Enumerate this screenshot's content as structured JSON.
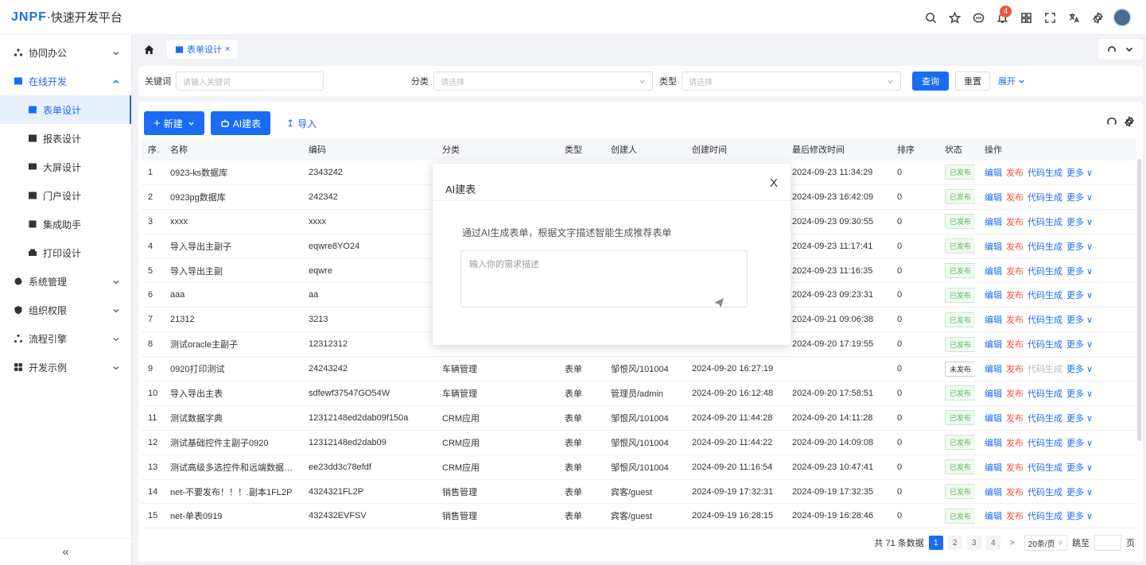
{
  "app": {
    "logo_brand": "JNPF",
    "logo_sep": "·",
    "logo_title": "快速开发平台",
    "notification_count": "4"
  },
  "sidebar": {
    "items": [
      {
        "label": "协同办公",
        "icon": "collab-icon"
      },
      {
        "label": "在线开发",
        "icon": "dev-icon"
      },
      {
        "label": "表单设计",
        "icon": "form-icon"
      },
      {
        "label": "报表设计",
        "icon": "report-icon"
      },
      {
        "label": "大屏设计",
        "icon": "screen-icon"
      },
      {
        "label": "门户设计",
        "icon": "portal-icon"
      },
      {
        "label": "集成助手",
        "icon": "integration-icon"
      },
      {
        "label": "打印设计",
        "icon": "print-icon"
      },
      {
        "label": "系统管理",
        "icon": "system-icon"
      },
      {
        "label": "组织权限",
        "icon": "org-icon"
      },
      {
        "label": "流程引擎",
        "icon": "flow-icon"
      },
      {
        "label": "开发示例",
        "icon": "example-icon"
      }
    ],
    "collapse_glyph": "«"
  },
  "tabs": {
    "active_label": "表单设计",
    "close_glyph": "×"
  },
  "filter": {
    "keyword_label": "关键词",
    "keyword_placeholder": "请输入关键词",
    "category_label": "分类",
    "category_placeholder": "请选择",
    "type_label": "类型",
    "type_placeholder": "请选择",
    "query_label": "查询",
    "reset_label": "重置",
    "expand_label": "展开"
  },
  "toolbar": {
    "new_label": "新建",
    "ai_label": "AI建表",
    "import_label": "导入"
  },
  "table": {
    "headers": [
      "序号",
      "名称",
      "编码",
      "分类",
      "类型",
      "创建人",
      "创建时间",
      "最后修改时间",
      "排序",
      "状态",
      "操作"
    ],
    "rows": [
      {
        "no": "1",
        "name": "0923-ks数据库",
        "code": "2343242",
        "category": "",
        "type": "",
        "creator": "",
        "created": "",
        "modified": "2024-09-23 11:34:29",
        "sort": "0",
        "status": "已发布"
      },
      {
        "no": "2",
        "name": "0923pg数据库",
        "code": "242342",
        "category": "",
        "type": "",
        "creator": "",
        "created": "",
        "modified": "2024-09-23 16:42:09",
        "sort": "0",
        "status": "已发布"
      },
      {
        "no": "3",
        "name": "xxxx",
        "code": "xxxx",
        "category": "",
        "type": "",
        "creator": "",
        "created": "",
        "modified": "2024-09-23 09:30:55",
        "sort": "0",
        "status": "已发布"
      },
      {
        "no": "4",
        "name": "导入导出主副子",
        "code": "eqwre8YO24",
        "category": "",
        "type": "",
        "creator": "",
        "created": "",
        "modified": "2024-09-23 11:17:41",
        "sort": "0",
        "status": "已发布"
      },
      {
        "no": "5",
        "name": "导入导出主副",
        "code": "eqwre",
        "category": "",
        "type": "",
        "creator": "",
        "created": "",
        "modified": "2024-09-23 11:16:35",
        "sort": "0",
        "status": "已发布"
      },
      {
        "no": "6",
        "name": "aaa",
        "code": "aa",
        "category": "",
        "type": "",
        "creator": "",
        "created": "",
        "modified": "2024-09-23 09:23:31",
        "sort": "0",
        "status": "已发布"
      },
      {
        "no": "7",
        "name": "21312",
        "code": "3213",
        "category": "",
        "type": "",
        "creator": "",
        "created": "",
        "modified": "2024-09-21 09:06:38",
        "sort": "0",
        "status": "已发布"
      },
      {
        "no": "8",
        "name": "测试oracle主副子",
        "code": "12312312",
        "category": "",
        "type": "",
        "creator": "",
        "created": "",
        "modified": "2024-09-20 17:19:55",
        "sort": "0",
        "status": "已发布"
      },
      {
        "no": "9",
        "name": "0920打印测试",
        "code": "24243242",
        "category": "车辆管理",
        "type": "表单",
        "creator": "邹恨风/101004",
        "created": "2024-09-20 16:27:19",
        "modified": "",
        "sort": "0",
        "status": "未发布"
      },
      {
        "no": "10",
        "name": "导入导出主表",
        "code": "sdfewf37547GO54W",
        "category": "车辆管理",
        "type": "表单",
        "creator": "管理员/admin",
        "created": "2024-09-20 16:12:48",
        "modified": "2024-09-20 17:58:51",
        "sort": "0",
        "status": "已发布"
      },
      {
        "no": "11",
        "name": "测试数据字典",
        "code": "12312148ed2dab09f150a",
        "category": "CRM应用",
        "type": "表单",
        "creator": "邹恨风/101004",
        "created": "2024-09-20 11:44:28",
        "modified": "2024-09-20 14:11:28",
        "sort": "0",
        "status": "已发布"
      },
      {
        "no": "12",
        "name": "测试基础控件主副子0920",
        "code": "12312148ed2dab09",
        "category": "CRM应用",
        "type": "表单",
        "creator": "邹恨风/101004",
        "created": "2024-09-20 11:44:22",
        "modified": "2024-09-20 14:09:08",
        "sort": "0",
        "status": "已发布"
      },
      {
        "no": "13",
        "name": "测试高级多选控件和远端数据主...",
        "code": "ee23dd3c78efdf",
        "category": "CRM应用",
        "type": "表单",
        "creator": "邹恨风/101004",
        "created": "2024-09-20 11:16:54",
        "modified": "2024-09-23 10:47:41",
        "sort": "0",
        "status": "已发布"
      },
      {
        "no": "14",
        "name": "net-不要发布！！！.副本1FL2P",
        "code": "4324321FL2P",
        "category": "销售管理",
        "type": "表单",
        "creator": "宾客/guest",
        "created": "2024-09-19 17:32:31",
        "modified": "2024-09-19 17:32:35",
        "sort": "0",
        "status": "已发布"
      },
      {
        "no": "15",
        "name": "net-单表0919",
        "code": "432432EVFSV",
        "category": "销售管理",
        "type": "表单",
        "creator": "宾客/guest",
        "created": "2024-09-19 16:28:15",
        "modified": "2024-09-19 16:28:46",
        "sort": "0",
        "status": "已发布"
      }
    ],
    "ops": {
      "edit": "编辑",
      "publish": "发布",
      "codegen": "代码生成",
      "more": "更多"
    }
  },
  "pagination": {
    "total_text": "共 71 条数据",
    "pages": [
      "1",
      "2",
      "3",
      "4"
    ],
    "next": ">",
    "size": "20条/页",
    "jump_label": "跳至",
    "page_suffix": "页"
  },
  "modal": {
    "title": "AI建表",
    "close": "X",
    "description": "通过AI生成表单，根据文字描述智能生成推荐表单",
    "placeholder": "输入你的需求描述"
  },
  "colors": {
    "primary": "#1a6cf5",
    "danger": "#f5533d",
    "success": "#5cb85c"
  }
}
